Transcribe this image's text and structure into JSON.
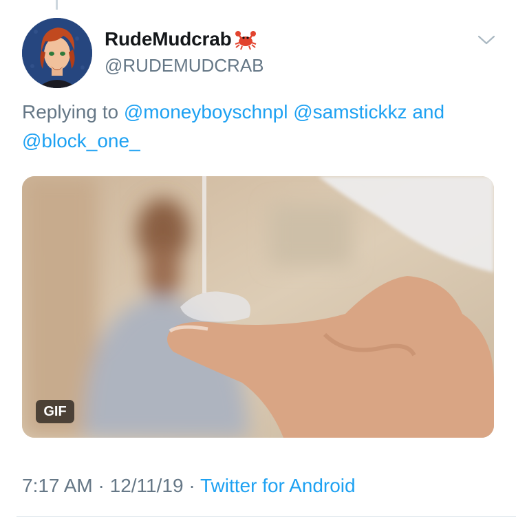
{
  "tweet": {
    "display_name": "RudeMudcrab",
    "handle": "@RUDEMUDCRAB",
    "name_emoji": "crab-icon",
    "reply": {
      "prefix": "Replying to",
      "mention_1": "@moneyboyschnpl",
      "mention_2": "@samstickkz",
      "conjunction": "and",
      "mention_3": "@block_one_"
    },
    "media": {
      "badge": "GIF"
    },
    "meta": {
      "time": "7:17 AM",
      "separator": "·",
      "date": "12/11/19",
      "source": "Twitter for Android"
    }
  },
  "colors": {
    "link": "#1da1f2",
    "secondary_text": "#657786",
    "primary_text": "#14171a",
    "divider": "#e6ecf0"
  }
}
